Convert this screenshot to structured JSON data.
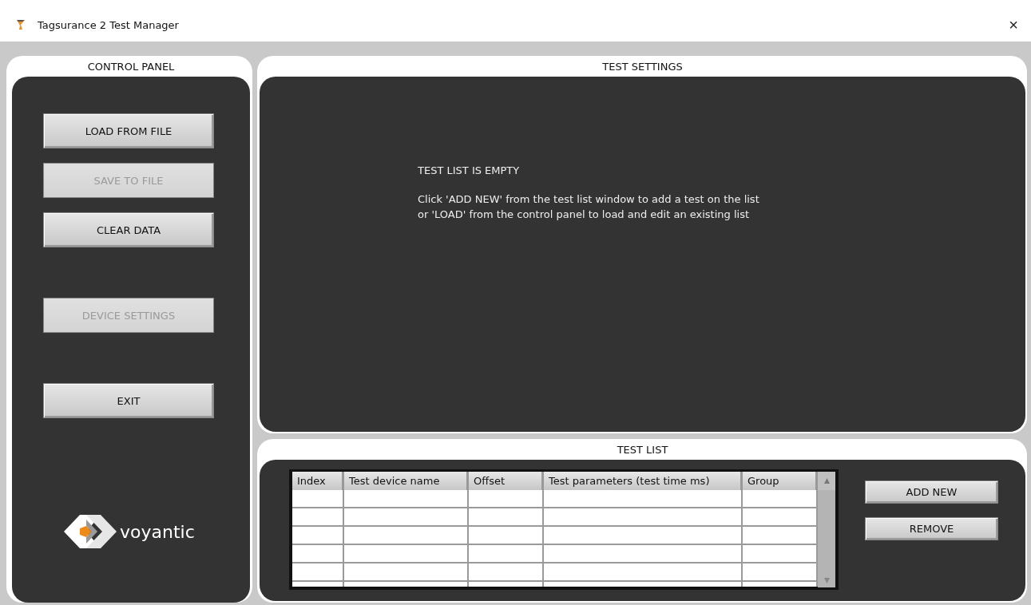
{
  "window": {
    "title": "Tagsurance 2 Test Manager",
    "close": "×"
  },
  "control_panel": {
    "title": "CONTROL PANEL",
    "buttons": [
      {
        "label": "LOAD FROM FILE",
        "disabled": false
      },
      {
        "label": "SAVE TO FILE",
        "disabled": true
      },
      {
        "label": "CLEAR DATA",
        "disabled": false
      },
      {
        "label": "DEVICE SETTINGS",
        "disabled": true
      },
      {
        "label": "EXIT",
        "disabled": false
      }
    ],
    "logo_text": "voyantic"
  },
  "test_settings": {
    "title": "TEST SETTINGS",
    "message_title": "TEST LIST IS EMPTY",
    "message_lines": [
      "Click 'ADD NEW' from the test list window to add a test on the list",
      "or 'LOAD' from the control panel to load and edit an existing list"
    ]
  },
  "test_list": {
    "title": "TEST LIST",
    "columns": [
      "Index",
      "Test device name",
      "Offset",
      "Test parameters (test time ms)",
      "Group"
    ],
    "buttons": [
      {
        "label": "ADD NEW",
        "disabled": false
      },
      {
        "label": "REMOVE",
        "disabled": false
      }
    ]
  }
}
